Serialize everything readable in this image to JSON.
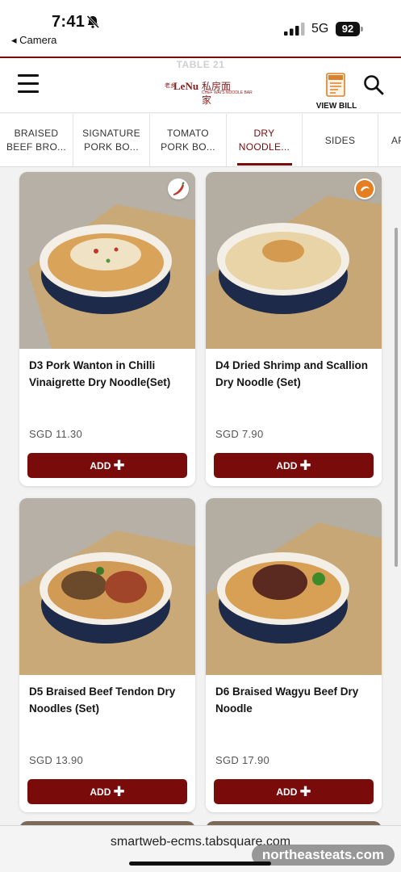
{
  "status_bar": {
    "time": "7:41",
    "back_app": "◂ Camera",
    "network": "5G",
    "battery": "92"
  },
  "header": {
    "table": "TABLE 21",
    "logo_prefix": "老乡",
    "logo_text": "LeNu",
    "logo_cn": "私房面家",
    "logo_sub": "CHEF WAI'S NOODLE BAR",
    "bill_label": "VIEW BILL"
  },
  "tabs": [
    {
      "label": "BRAISED\nBEEF BRO...",
      "active": false
    },
    {
      "label": "SIGNATURE\nPORK BO...",
      "active": false
    },
    {
      "label": "TOMATO\nPORK BO...",
      "active": false
    },
    {
      "label": "DRY\nNOODLE...",
      "active": true
    },
    {
      "label": "SIDES",
      "active": false
    },
    {
      "label": "AP",
      "active": false
    }
  ],
  "products": [
    {
      "name": "D3 Pork Wanton in Chilli Vinaigrette Dry Noodle(Set)",
      "price": "SGD 11.30",
      "add_label": "ADD",
      "badge": "chilli-icon"
    },
    {
      "name": "D4 Dried Shrimp and Scallion Dry Noodle (Set)",
      "price": "SGD 7.90",
      "add_label": "ADD",
      "badge": "shrimp-icon"
    },
    {
      "name": "D5 Braised Beef Tendon Dry Noodles (Set)",
      "price": "SGD 13.90",
      "add_label": "ADD",
      "badge": ""
    },
    {
      "name": "D6 Braised Wagyu Beef Dry Noodle",
      "price": "SGD 17.90",
      "add_label": "ADD",
      "badge": ""
    }
  ],
  "browser": {
    "url": "smartweb-ecms.tabsquare.com",
    "watermark": "northeasteats.com"
  },
  "colors": {
    "accent": "#7a0b0b",
    "background": "#f2f2f2"
  }
}
